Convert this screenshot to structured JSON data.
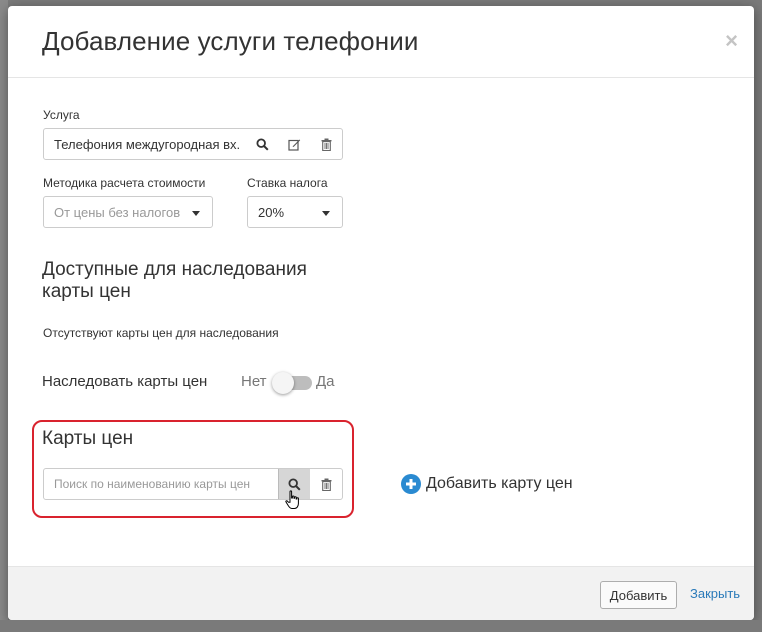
{
  "modal": {
    "title": "Добавление услуги телефонии",
    "close_glyph": "×"
  },
  "service": {
    "label": "Услуга",
    "value": "Телефония междугородная вх."
  },
  "calc_method": {
    "label": "Методика расчета стоимости",
    "placeholder": "От цены без налогов"
  },
  "tax_rate": {
    "label": "Ставка налога",
    "value": "20%"
  },
  "inherit_section": {
    "title_line1": "Доступные для наследования",
    "title_line2": "карты цен",
    "empty_text": "Отсутствуют карты цен для наследования"
  },
  "inherit_toggle": {
    "label": "Наследовать карты цен",
    "off_label": "Нет",
    "on_label": "Да",
    "state": "off"
  },
  "price_cards": {
    "title": "Карты цен",
    "search_placeholder": "Поиск по наименованию карты цен",
    "add_link": "Добавить карту цен"
  },
  "footer": {
    "add_button": "Добавить",
    "close_link": "Закрыть"
  },
  "colors": {
    "highlight_border": "#d9232e",
    "link": "#2a7ab9",
    "accent": "#2a8ad1"
  },
  "icons": [
    "search-icon",
    "edit-icon",
    "trash-icon",
    "chevron-down-icon",
    "plus-circle-icon",
    "hand-cursor-icon",
    "close-icon"
  ]
}
